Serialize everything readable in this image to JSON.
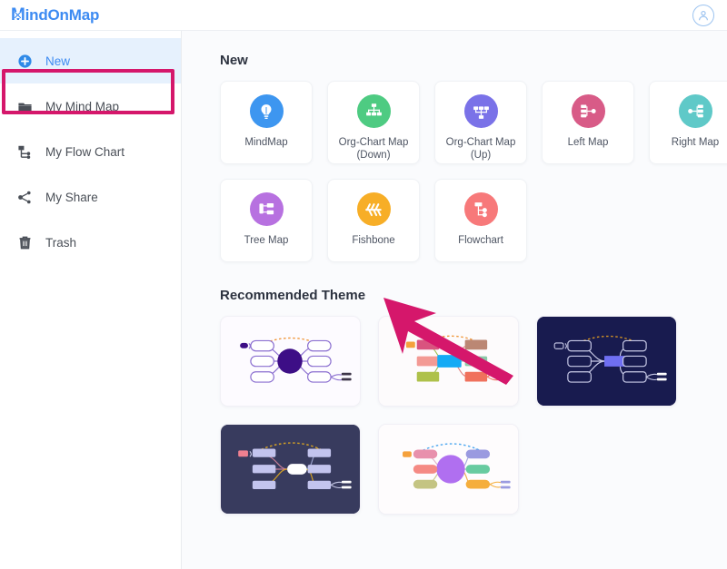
{
  "header": {
    "logo_first_letter": "M",
    "logo_rest": "indOnMap",
    "avatar_icon": "user-circle-icon"
  },
  "sidebar": {
    "items": [
      {
        "label": "New",
        "icon": "plus-circle-icon",
        "active": true
      },
      {
        "label": "My Mind Map",
        "icon": "folder-icon",
        "active": false
      },
      {
        "label": "My Flow Chart",
        "icon": "flowchart-icon",
        "active": false
      },
      {
        "label": "My Share",
        "icon": "share-icon",
        "active": false
      },
      {
        "label": "Trash",
        "icon": "trash-icon",
        "active": false
      }
    ]
  },
  "main": {
    "new_section_title": "New",
    "theme_section_title": "Recommended Theme",
    "cards": [
      {
        "label": "MindMap",
        "icon": "lightbulb-icon",
        "color": "#3d96f0"
      },
      {
        "label": "Org-Chart Map (Down)",
        "icon": "org-chart-down-icon",
        "color": "#4ecb82"
      },
      {
        "label": "Org-Chart Map (Up)",
        "icon": "org-chart-up-icon",
        "color": "#7a72e8"
      },
      {
        "label": "Left Map",
        "icon": "left-map-icon",
        "color": "#d85b87"
      },
      {
        "label": "Right Map",
        "icon": "right-map-icon",
        "color": "#5fc9c8"
      },
      {
        "label": "Tree Map",
        "icon": "tree-map-icon",
        "color": "#b濃"
      },
      {
        "label": "Fishbone",
        "icon": "fishbone-icon",
        "color": "#f7ae27"
      },
      {
        "label": "Flowchart",
        "icon": "flowchart-card-icon",
        "color": "#f7797a"
      }
    ],
    "card_colors": [
      "#3d96f0",
      "#4ecb82",
      "#7a72e8",
      "#d85b87",
      "#5fc9c8",
      "#b771e0",
      "#f7ae27",
      "#f7797a"
    ],
    "themes": [
      {
        "name": "theme-purple-light",
        "background": "#fdfbff",
        "center": "#3d0e86",
        "node": "#ffffff",
        "stroke": "#8b6fd0",
        "accent": "#f29c3f"
      },
      {
        "name": "theme-colorful-light",
        "background": "#fdfbfc",
        "center": "#14aaf5",
        "node": "#d9537f",
        "stroke": "#e8a0a8",
        "accent": "#f29c3f"
      },
      {
        "name": "theme-dark-navy",
        "background": "#181b4f",
        "center": "#6f6ff2",
        "node": "#181b4f",
        "stroke": "#c9cbe8",
        "accent": "#d39324"
      },
      {
        "name": "theme-dark-slate",
        "background": "#383b5e",
        "center": "#ffffff",
        "node": "#c3c4ee",
        "stroke": "#a9aad8",
        "accent": "#d3a024"
      },
      {
        "name": "theme-pastel-light",
        "background": "#fefcfd",
        "center": "#b06ff0",
        "node": "#e890ac",
        "stroke": "#e2b6c8",
        "accent": "#4aa6ef"
      }
    ]
  },
  "annotations": {
    "highlight_box_target": "New",
    "highlight_box_color": "#d5176b",
    "arrow_color": "#d5176b",
    "arrow_points_to": "Fishbone"
  }
}
